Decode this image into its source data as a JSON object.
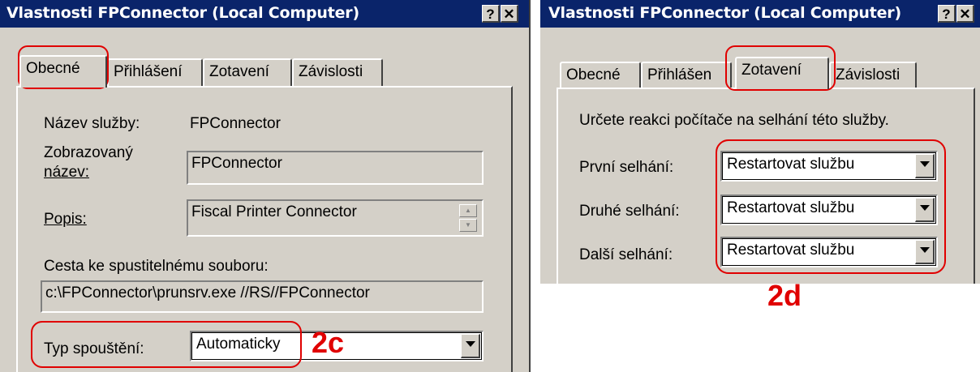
{
  "left_dialog": {
    "title": "Vlastnosti FPConnector (Local Computer)",
    "help_label": "?",
    "close_label": "✕",
    "tabs": [
      {
        "label": "Obecné"
      },
      {
        "label": "Přihlášení"
      },
      {
        "label": "Zotavení"
      },
      {
        "label": "Závislosti"
      }
    ],
    "service_name_label": "Název služby:",
    "service_name_value": "FPConnector",
    "display_name_label_line1": "Zobrazovaný",
    "display_name_label_line2": "název:",
    "display_name_value": "FPConnector",
    "description_label": "Popis:",
    "description_value": "Fiscal Printer Connector",
    "path_label": "Cesta ke spustitelnému souboru:",
    "path_value": "c:\\FPConnector\\prunsrv.exe //RS//FPConnector",
    "startup_type_label": "Typ spouštění:",
    "startup_type_value": "Automaticky",
    "annotation": "2c"
  },
  "right_dialog": {
    "title": "Vlastnosti FPConnector (Local Computer)",
    "help_label": "?",
    "close_label": "✕",
    "tabs": [
      {
        "label": "Obecné"
      },
      {
        "label": "Přihlášen"
      },
      {
        "label": "Zotavení"
      },
      {
        "label": "Závislosti"
      }
    ],
    "instruction": "Určete reakci počítače na selhání této služby.",
    "first_failure_label": "První selhání:",
    "first_failure_value": "Restartovat službu",
    "second_failure_label": "Druhé selhání:",
    "second_failure_value": "Restartovat službu",
    "subsequent_failure_label": "Další selhání:",
    "subsequent_failure_value": "Restartovat službu",
    "annotation": "2d"
  },
  "colors": {
    "titlebar": "#0a246a",
    "dialog_face": "#d4d0c8",
    "annotation_red": "#e00000"
  },
  "icons": [
    "help-icon",
    "close-icon",
    "dropdown-arrow-icon",
    "spin-up-icon",
    "spin-down-icon"
  ]
}
